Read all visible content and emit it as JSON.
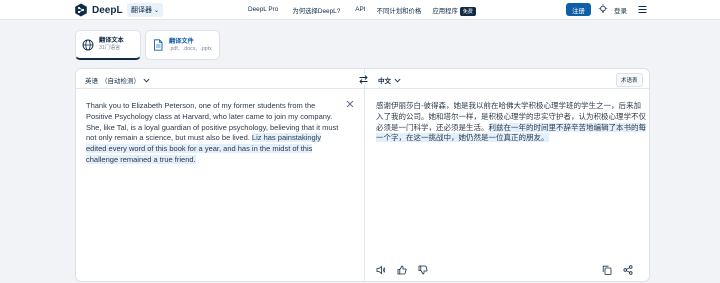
{
  "header": {
    "logo_text": "DeepL",
    "translator_menu": "翻译器",
    "nav": [
      "DeepL Pro",
      "为何选择DeepL?",
      "API",
      "不同计划和价格",
      "应用程序"
    ],
    "free_badge": "免费",
    "register_label": "注册",
    "login_label": "登录"
  },
  "tabs": [
    {
      "label": "翻译文本",
      "sub": "31门语言"
    },
    {
      "label": "翻译文件",
      "sub": ".pdf、.docx、.pptx"
    }
  ],
  "translator": {
    "source_lang": "英语",
    "source_lang_sub": "（自动检测）",
    "target_lang": "中文",
    "glossary_label": "术语表",
    "source_text_a": "Thank you to Elizabeth Peterson, one of my former students from the Positive Psychology class at Harvard, who later came to join my company. She, like Tal, is a loyal guardian of positive psychology, believing that it must not only remain a science, but must also be lived. ",
    "source_text_b": "Liz has painstakingly edited every word of this book for a year, and has in the midst of this challenge remained a true friend.",
    "target_text_a": "感谢伊丽莎白-彼得森，她是我以前在哈佛大学积极心理学班的学生之一，后来加入了我的公司。她和塔尔一样，是积极心理学的忠实守护者，认为积极心理学不仅必须是一门科学，还必须是生活。",
    "target_text_b": "利兹在一年的时间里不辞辛苦地编辑了本书的每一个字，在这一挑战中，她仍然是一位真正的朋友。"
  },
  "colors": {
    "brand": "#0f2b46",
    "accent": "#0f5ea8",
    "highlight": "#e3effb"
  }
}
